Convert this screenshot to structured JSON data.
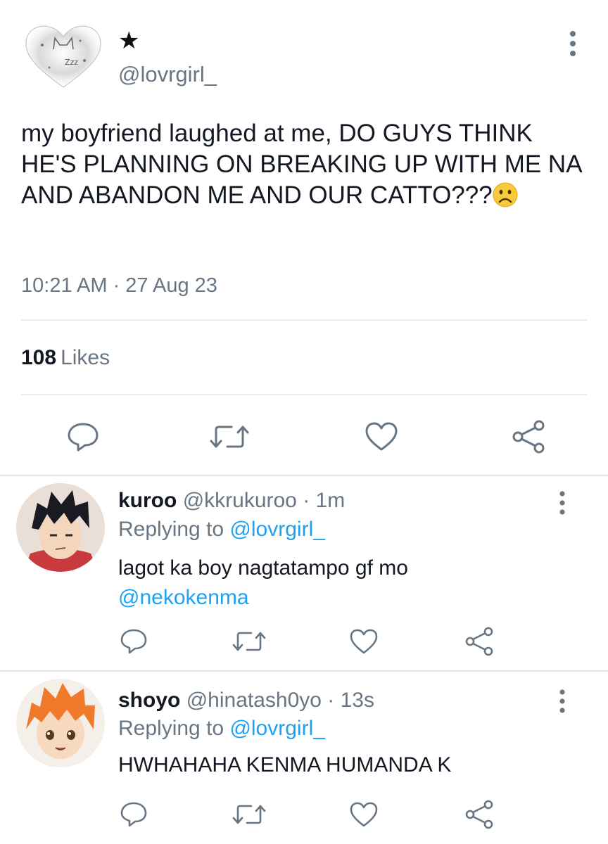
{
  "main_tweet": {
    "display_name": "★",
    "handle": "@lovrgirl_",
    "text": "my boyfriend laughed at me, DO GUYS THINK HE'S PLANNING ON BREAKING UP WITH ME NA AND ABANDON ME AND OUR CATTO???",
    "emoji": "frowning-face",
    "timestamp": "10:21 AM · 27 Aug 23",
    "likes_count": "108",
    "likes_label": "Likes",
    "avatar_text": "Zzz"
  },
  "replies": [
    {
      "name": "kuroo",
      "handle": "@kkrukuroo",
      "time": "· 1m",
      "replying_prefix": "Replying to",
      "replying_handle": "@lovrgirl_",
      "text": "lagot ka boy nagtatampo gf mo",
      "mention": "@nekokenma"
    },
    {
      "name": "shoyo",
      "handle": "@hinatash0yo",
      "time": "· 13s",
      "replying_prefix": "Replying to",
      "replying_handle": "@lovrgirl_",
      "text": "HWHAHAHA KENMA HUMANDA K",
      "mention": ""
    }
  ],
  "colors": {
    "text": "#141823",
    "muted": "#687684",
    "link": "#1da1f2",
    "divider": "#e6ecf0"
  },
  "icons": [
    "more-vertical-icon",
    "reply-icon",
    "retweet-icon",
    "like-icon",
    "share-icon"
  ]
}
